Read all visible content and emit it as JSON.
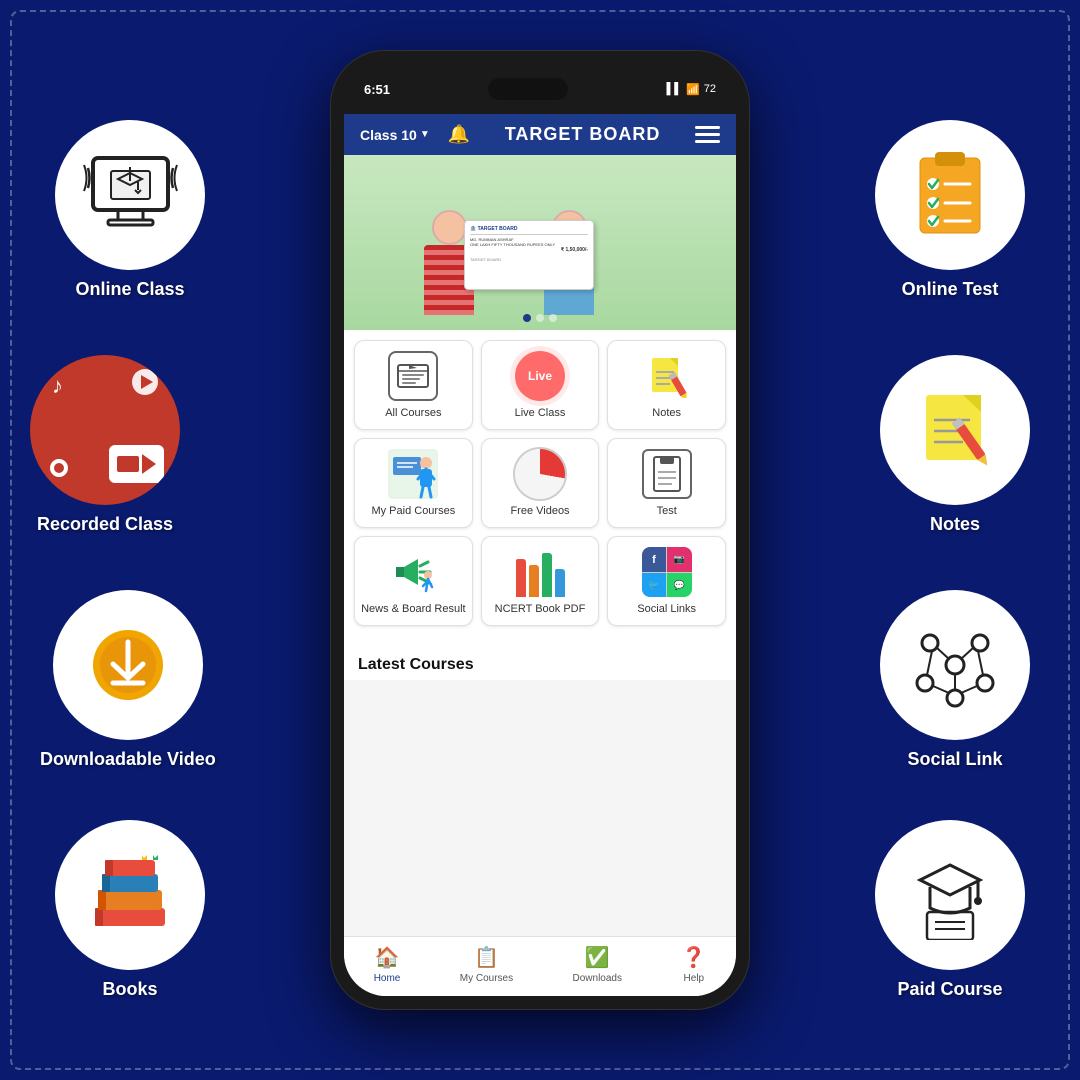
{
  "page": {
    "background_color": "#0a1a6e"
  },
  "left_circles": [
    {
      "id": "online-class",
      "label": "Online Class",
      "icon_type": "monitor-hat"
    },
    {
      "id": "recorded-class",
      "label": "Recorded\nClass",
      "icon_type": "video-record"
    },
    {
      "id": "downloadable-video",
      "label": "Downloadable\nVideo",
      "icon_type": "download"
    },
    {
      "id": "books",
      "label": "Books",
      "icon_type": "books-stack"
    }
  ],
  "right_circles": [
    {
      "id": "online-test",
      "label": "Online Test",
      "icon_type": "checklist"
    },
    {
      "id": "notes",
      "label": "Notes",
      "icon_type": "sticky-note"
    },
    {
      "id": "social-link",
      "label": "Social Link",
      "icon_type": "network"
    },
    {
      "id": "paid-course",
      "label": "Paid Course",
      "icon_type": "graduation-list"
    }
  ],
  "phone": {
    "status_bar": {
      "time": "6:51",
      "signal": "▌▌ ▌▌",
      "wifi": "WiFi",
      "battery": "72"
    },
    "header": {
      "class_selector": "Class 10",
      "title": "TARGET BOARD",
      "bell_label": "🔔",
      "menu_label": "≡"
    },
    "menu_grid": [
      {
        "row": 1,
        "items": [
          {
            "id": "all-courses",
            "label": "All Courses",
            "icon_type": "outline-board"
          },
          {
            "id": "live-class",
            "label": "Live Class",
            "icon_type": "live-red"
          },
          {
            "id": "notes-cell",
            "label": "Notes",
            "icon_type": "notes-orange"
          }
        ]
      },
      {
        "row": 2,
        "items": [
          {
            "id": "my-paid-courses",
            "label": "My Paid Courses",
            "icon_type": "teacher-img"
          },
          {
            "id": "free-videos",
            "label": "Free Videos",
            "icon_type": "pie-red"
          },
          {
            "id": "test",
            "label": "Test",
            "icon_type": "phone-outline"
          }
        ]
      },
      {
        "row": 3,
        "items": [
          {
            "id": "news-board",
            "label": "News & Board Result",
            "icon_type": "megaphone"
          },
          {
            "id": "ncert-pdf",
            "label": "NCERT Book PDF",
            "icon_type": "books-colored"
          },
          {
            "id": "social-links",
            "label": "Social Links",
            "icon_type": "social-grid"
          }
        ]
      }
    ],
    "latest_courses_title": "Latest Courses",
    "bottom_nav": [
      {
        "id": "home",
        "label": "Home",
        "icon": "🏠",
        "active": true
      },
      {
        "id": "my-courses",
        "label": "My Courses",
        "icon": "📋",
        "active": false
      },
      {
        "id": "downloads",
        "label": "Downloads",
        "icon": "✅",
        "active": false
      },
      {
        "id": "help",
        "label": "Help",
        "icon": "❓",
        "active": false
      }
    ]
  }
}
